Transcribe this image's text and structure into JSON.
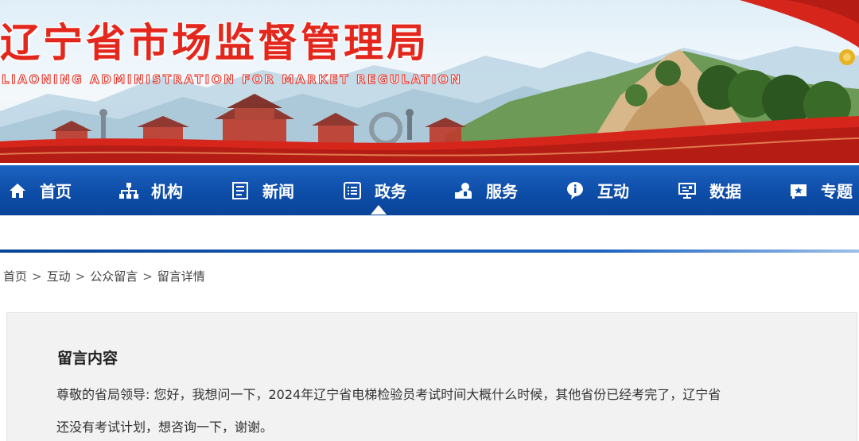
{
  "header": {
    "title": "辽宁省市场监督管理局",
    "subtitle": "LIAONING ADMINISTRATION FOR MARKET REGULATION"
  },
  "nav": {
    "items": [
      {
        "label": "首页",
        "icon": "home-icon"
      },
      {
        "label": "机构",
        "icon": "org-chart-icon"
      },
      {
        "label": "新闻",
        "icon": "news-icon"
      },
      {
        "label": "政务",
        "icon": "list-icon",
        "active": true
      },
      {
        "label": "服务",
        "icon": "service-icon"
      },
      {
        "label": "互动",
        "icon": "info-icon"
      },
      {
        "label": "数据",
        "icon": "data-icon"
      },
      {
        "label": "专题",
        "icon": "topic-icon"
      }
    ]
  },
  "breadcrumb": {
    "items": [
      "首页",
      "互动",
      "公众留言",
      "留言详情"
    ],
    "separator": ">"
  },
  "message": {
    "heading": "留言内容",
    "line1": "尊敬的省局领导: 您好，我想问一下，2024年辽宁省电梯检验员考试时间大概什么时候，其他省份已经考完了，辽宁省",
    "line2": "还没有考试计划，想咨询一下，谢谢。"
  },
  "colors": {
    "brand_red": "#e3271c",
    "nav_blue": "#0d4da8",
    "panel_bg": "#f2f2f2"
  }
}
